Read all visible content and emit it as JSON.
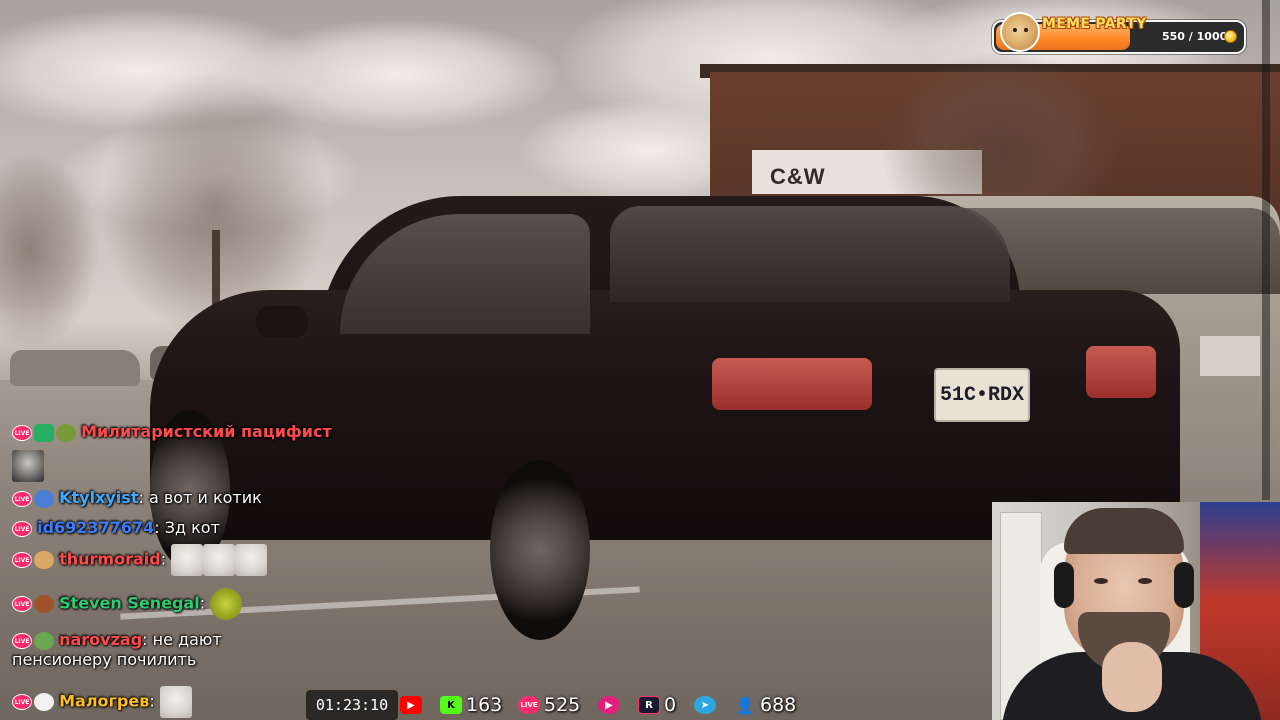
{
  "meme_party": {
    "title": "MEME PARTY",
    "count": "550 / 1000",
    "progress": 0.55,
    "icon": "doge-icon",
    "coin_icon": "coin-icon"
  },
  "scene": {
    "plate": "51C•RDX",
    "sign": "C&W"
  },
  "chat": [
    {
      "user": "Милитаристский пацифист",
      "message": "",
      "color": "#ff4b4b",
      "badges": [
        "live-badge",
        "pencil-icon",
        "frog-icon"
      ],
      "emotes": [
        "cat-emote"
      ]
    },
    {
      "user": "Ktylxyist",
      "message": "а вот и котик",
      "color": "#3fa8ff",
      "badges": [
        "live-badge",
        "frog-icon"
      ],
      "emotes": []
    },
    {
      "user": "id692377674",
      "message": "Зд кот",
      "color": "#3b7dff",
      "badges": [
        "live-badge"
      ],
      "emotes": []
    },
    {
      "user": "thurmoraid",
      "message": "",
      "color": "#ff4b4b",
      "badges": [
        "live-badge",
        "doge-icon"
      ],
      "emotes": [
        "cat-emote",
        "cat-emote",
        "cat-emote"
      ]
    },
    {
      "user": "Steven Senegal",
      "message": "",
      "color": "#2ecc71",
      "badges": [
        "live-badge",
        "avatar-icon"
      ],
      "emotes": [
        "pepe-emote"
      ]
    },
    {
      "user": "narovzag",
      "message": "не дают пенсионеру почилить",
      "color": "#ff4b4b",
      "badges": [
        "live-badge",
        "frog-icon"
      ],
      "emotes": []
    },
    {
      "user": "Малогрев",
      "message": "",
      "color": "#ffbf1f",
      "badges": [
        "live-badge",
        "cat-icon"
      ],
      "emotes": [
        "cat-emote"
      ]
    }
  ],
  "stats": {
    "timer": "01:23:10",
    "kick": "163",
    "vk_live": "525",
    "rutube": "0",
    "viewers": "688",
    "icons": [
      "youtube-icon",
      "kick-icon",
      "vklive-icon",
      "youtube-play-icon",
      "rutube-icon",
      "telegram-icon",
      "viewers-icon"
    ],
    "colors": {
      "youtube": "#ff0000",
      "kick": "#53fc18",
      "vklive": "#ff2a6d",
      "rutube": "#1a1a2e",
      "telegram": "#2ca5e0",
      "viewers": "#3fa8ff"
    }
  }
}
